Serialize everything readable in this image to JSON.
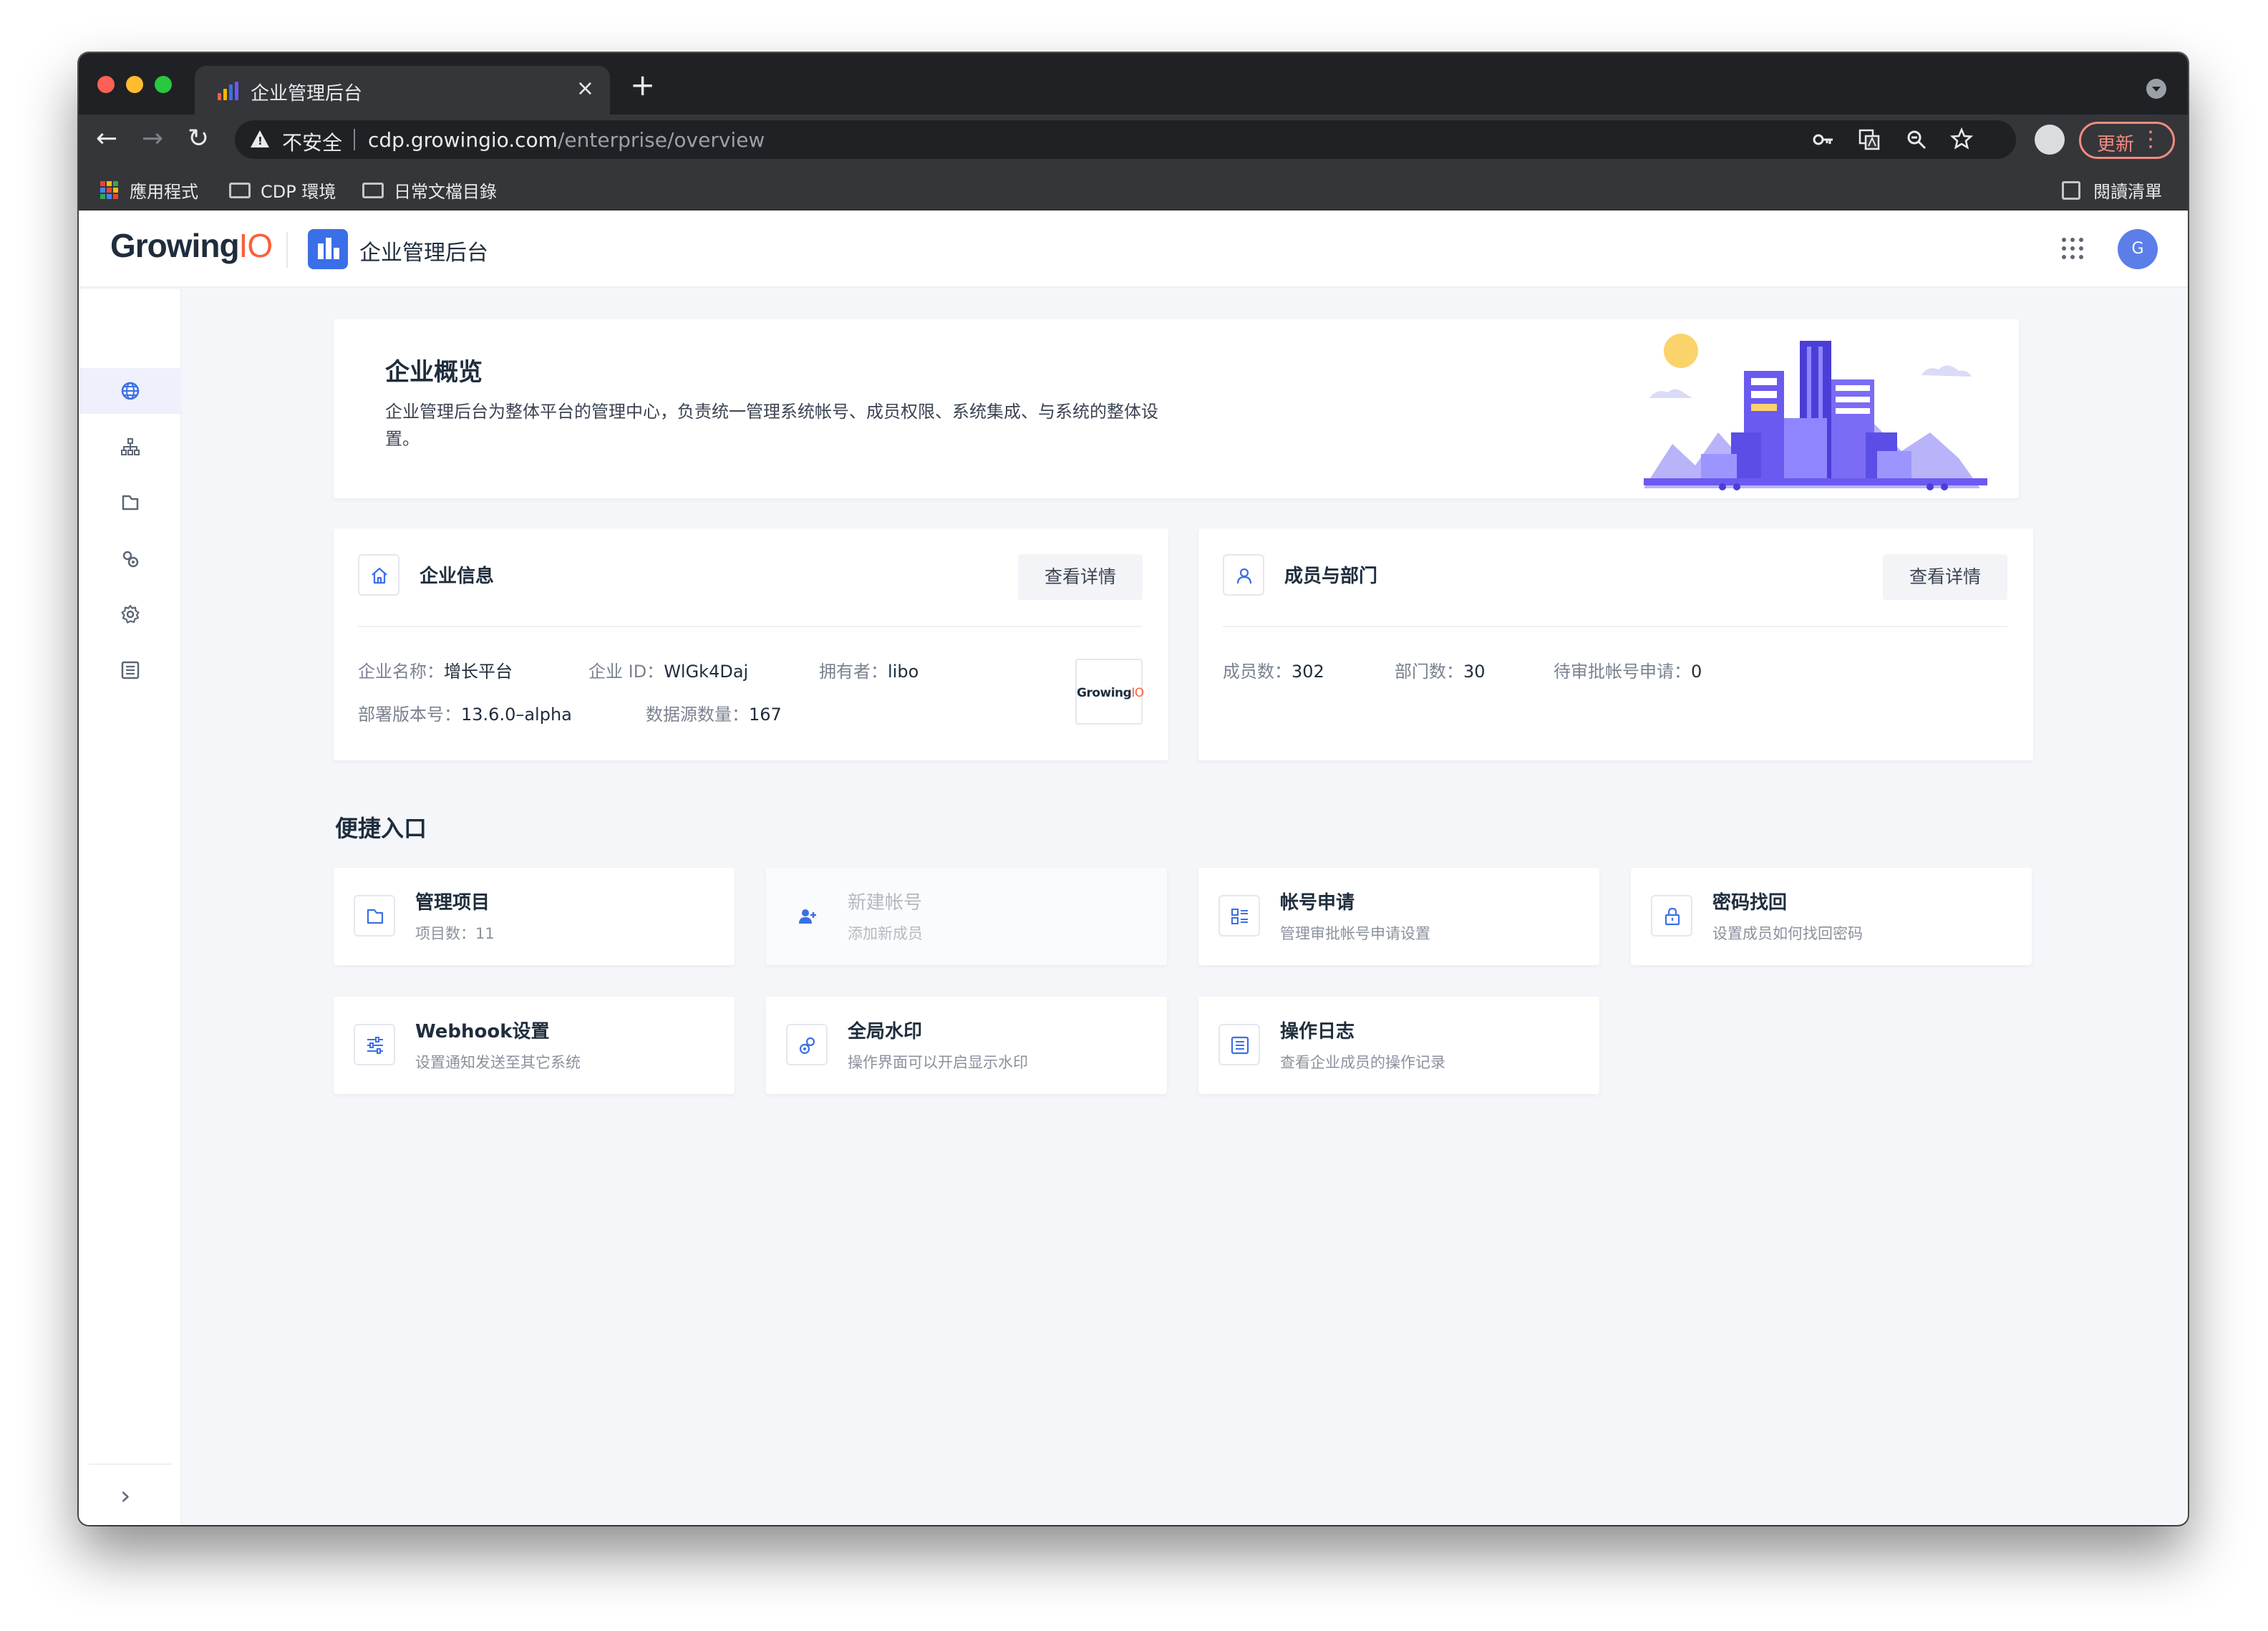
{
  "browser": {
    "tab_title": "企业管理后台",
    "tab_close": "×",
    "new_tab": "+",
    "back": "←",
    "forward": "→",
    "reload": "↻",
    "security_label": "不安全",
    "url_host": "cdp.growingio.com",
    "url_path": "/enterprise/overview",
    "update_label": "更新",
    "menu_dots": "⋮",
    "bookmarks": [
      {
        "label": "應用程式",
        "icon": "apps-grid-icon"
      },
      {
        "label": "CDP 環境",
        "icon": "folder-icon"
      },
      {
        "label": "日常文檔目錄",
        "icon": "folder-icon"
      }
    ],
    "reading_list": "閱讀清單"
  },
  "app": {
    "logo_text": "Growing",
    "logo_io": "IO",
    "title": "企业管理后台",
    "avatar_initial": "G",
    "sidebar_expand": "›"
  },
  "overview": {
    "title": "企业概览",
    "description": "企业管理后台为整体平台的管理中心，负责统一管理系统帐号、成员权限、系统集成、与系统的整体设置。"
  },
  "enterprise_info": {
    "title": "企业信息",
    "detail_button": "查看详情",
    "name_label": "企业名称：",
    "name_value": "增长平台",
    "id_label": "企业 ID：",
    "id_value": "WlGk4Daj",
    "owner_label": "拥有者：",
    "owner_value": "libo",
    "version_label": "部署版本号：",
    "version_value": "13.6.0–alpha",
    "datasource_label": "数据源数量：",
    "datasource_value": "167",
    "mini_logo_text": "Growing",
    "mini_logo_io": "IO"
  },
  "members": {
    "title": "成员与部门",
    "detail_button": "查看详情",
    "member_label": "成员数：",
    "member_value": "302",
    "dept_label": "部门数：",
    "dept_value": "30",
    "pending_label": "待审批帐号申请：",
    "pending_value": "0"
  },
  "quick_access": {
    "title": "便捷入口",
    "items": [
      {
        "title": "管理项目",
        "subtitle": "项目数：11",
        "icon": "folder-icon",
        "disabled": false
      },
      {
        "title": "新建帐号",
        "subtitle": "添加新成员",
        "icon": "add-user-icon",
        "disabled": true
      },
      {
        "title": "帐号申请",
        "subtitle": "管理审批帐号申请设置",
        "icon": "form-list-icon",
        "disabled": false
      },
      {
        "title": "密码找回",
        "subtitle": "设置成员如何找回密码",
        "icon": "lock-icon",
        "disabled": false
      },
      {
        "title": "Webhook设置",
        "subtitle": "设置通知发送至其它系统",
        "icon": "sliders-icon",
        "disabled": false
      },
      {
        "title": "全局水印",
        "subtitle": "操作界面可以开启显示水印",
        "icon": "gears-icon",
        "disabled": false
      },
      {
        "title": "操作日志",
        "subtitle": "查看企业成员的操作记录",
        "icon": "log-icon",
        "disabled": false
      }
    ]
  },
  "colors": {
    "accent": "#3b6fe7",
    "brand_io": "#fc5f3a",
    "page_bg": "#f5f6fa",
    "illustration": "#6a5af0"
  }
}
